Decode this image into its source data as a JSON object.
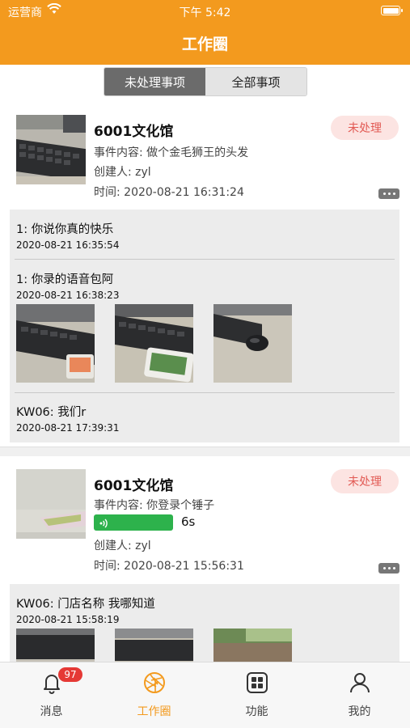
{
  "status_bar": {
    "carrier": "运营商",
    "time": "下午 5:42"
  },
  "nav": {
    "title": "工作圈"
  },
  "segment": {
    "pending": "未处理事项",
    "all": "全部事项"
  },
  "cards": [
    {
      "title": "6001文化馆",
      "status": "未处理",
      "content": "事件内容: 做个金毛狮王的头发",
      "creator": "创建人: zyl",
      "time": "时间: 2020-08-21 16:31:24",
      "replies": [
        {
          "text": "1:  你说你真的快乐",
          "time": "2020-08-21 16:35:54"
        },
        {
          "text": "1:  你录的语音包阿",
          "time": "2020-08-21 16:38:23"
        },
        {
          "text": "KW06:  我们r",
          "time": "2020-08-21 17:39:31"
        }
      ]
    },
    {
      "title": "6001文化馆",
      "status": "未处理",
      "content": "事件内容: 你登录个锤子",
      "voice_length": "6s",
      "creator": "创建人: zyl",
      "time": "时间: 2020-08-21 15:56:31",
      "replies": [
        {
          "text": "KW06:  门店名称 我哪知道",
          "time": "2020-08-21 15:58:19"
        }
      ]
    }
  ],
  "tabbar": {
    "messages": {
      "label": "消息",
      "badge": "97"
    },
    "work_circle": {
      "label": "工作圈"
    },
    "functions": {
      "label": "功能"
    },
    "mine": {
      "label": "我的"
    }
  },
  "colors": {
    "accent": "#f39a1e",
    "status_bg": "#fce4e2",
    "status_text": "#e25a54",
    "voice": "#2db24c",
    "badge": "#e53935"
  }
}
